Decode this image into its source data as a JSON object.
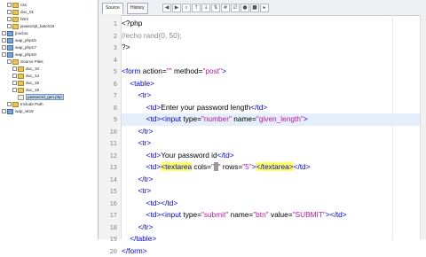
{
  "sidebar": {
    "items": [
      {
        "label": "css",
        "kind": "folder",
        "indent": 1
      },
      {
        "label": "duc_01",
        "kind": "folder",
        "indent": 1
      },
      {
        "label": "html",
        "kind": "folder",
        "indent": 1
      },
      {
        "label": "javascript_batch15",
        "kind": "folder",
        "indent": 1
      },
      {
        "label": "jnuclou",
        "kind": "project",
        "indent": 0
      },
      {
        "label": "wap_php15",
        "kind": "project",
        "indent": 0
      },
      {
        "label": "wap_php17",
        "kind": "project",
        "indent": 0
      },
      {
        "label": "wap_php18",
        "kind": "project",
        "indent": 0
      },
      {
        "label": "Source Files",
        "kind": "folder",
        "indent": 1
      },
      {
        "label": "duc_10",
        "kind": "folder",
        "indent": 2
      },
      {
        "label": "duc_14",
        "kind": "folder",
        "indent": 2
      },
      {
        "label": "duc_15",
        "kind": "folder",
        "indent": 2
      },
      {
        "label": "duc_16",
        "kind": "folder",
        "indent": 2
      },
      {
        "label": "password_gen.php",
        "kind": "file",
        "indent": 3,
        "selected": true
      },
      {
        "label": "Include Path",
        "kind": "folder",
        "indent": 1
      },
      {
        "label": "wap_wt19",
        "kind": "project",
        "indent": 0
      }
    ]
  },
  "toolbar": {
    "source_tab": "Source",
    "history_tab": "History",
    "buttons": [
      "back-icon",
      "forward-icon",
      "find-icon",
      "prev-icon",
      "next-icon",
      "toggle-icon",
      "comment-icon",
      "uncomment-icon",
      "record-icon",
      "stop-icon",
      "play-icon"
    ]
  },
  "editor": {
    "current_line": 9,
    "lines": [
      {
        "n": "1",
        "segments": [
          {
            "t": "<?php",
            "c": "kw"
          }
        ]
      },
      {
        "n": "2",
        "segments": [
          {
            "t": "//echo ",
            "c": "cm"
          },
          {
            "t": "rand",
            "c": "cm"
          },
          {
            "t": "(0, 50);",
            "c": "cm"
          }
        ]
      },
      {
        "n": "3",
        "segments": [
          {
            "t": "?>",
            "c": "kw"
          }
        ]
      },
      {
        "n": "4",
        "segments": []
      },
      {
        "n": "5",
        "segments": [
          {
            "t": "<form ",
            "c": "tag"
          },
          {
            "t": "action=",
            "c": "attr"
          },
          {
            "t": "\"\" ",
            "c": "str"
          },
          {
            "t": "method=",
            "c": "attr"
          },
          {
            "t": "\"post\"",
            "c": "str"
          },
          {
            "t": ">",
            "c": "tag"
          }
        ]
      },
      {
        "n": "6",
        "segments": [
          {
            "t": "    <table>",
            "c": "tag"
          }
        ]
      },
      {
        "n": "7",
        "segments": [
          {
            "t": "        <tr>",
            "c": "tag"
          }
        ]
      },
      {
        "n": "8",
        "segments": [
          {
            "t": "            <td>",
            "c": "tag"
          },
          {
            "t": "Enter your password length",
            "c": "kw"
          },
          {
            "t": "</td>",
            "c": "tag"
          }
        ]
      },
      {
        "n": "9",
        "segments": [
          {
            "t": "            <td><input ",
            "c": "tag"
          },
          {
            "t": "type=",
            "c": "attr"
          },
          {
            "t": "\"number\" ",
            "c": "str"
          },
          {
            "t": "name=",
            "c": "attr"
          },
          {
            "t": "\"given_length\"",
            "c": "str"
          },
          {
            "t": ">",
            "c": "tag"
          }
        ]
      },
      {
        "n": "10",
        "segments": [
          {
            "t": "        </tr>",
            "c": "tag"
          }
        ]
      },
      {
        "n": "11",
        "segments": [
          {
            "t": "        <tr>",
            "c": "tag"
          }
        ]
      },
      {
        "n": "12",
        "segments": [
          {
            "t": "            <td>",
            "c": "tag"
          },
          {
            "t": "Your password id",
            "c": "kw"
          },
          {
            "t": "</td>",
            "c": "tag"
          }
        ]
      },
      {
        "n": "13",
        "segments": [
          {
            "t": "            <td>",
            "c": "tag"
          },
          {
            "t": "<textarea",
            "c": "tag hl-mark"
          },
          {
            "t": " cols=",
            "c": "attr"
          },
          {
            "t": "\"",
            "c": "str"
          },
          {
            "t": "  ",
            "c": "str hl-cursor"
          },
          {
            "t": "\" ",
            "c": "str"
          },
          {
            "t": "rows=",
            "c": "attr"
          },
          {
            "t": "\"5\"",
            "c": "str"
          },
          {
            "t": ">",
            "c": "tag"
          },
          {
            "t": "</textarea>",
            "c": "tag hl-mark"
          },
          {
            "t": "</td>",
            "c": "tag"
          }
        ]
      },
      {
        "n": "14",
        "segments": [
          {
            "t": "        </tr>",
            "c": "tag"
          }
        ]
      },
      {
        "n": "15",
        "segments": [
          {
            "t": "        <tr>",
            "c": "tag"
          }
        ]
      },
      {
        "n": "16",
        "segments": [
          {
            "t": "            <td></td>",
            "c": "tag"
          }
        ]
      },
      {
        "n": "17",
        "segments": [
          {
            "t": "            <td><input ",
            "c": "tag"
          },
          {
            "t": "type=",
            "c": "attr"
          },
          {
            "t": "\"submit\" ",
            "c": "str"
          },
          {
            "t": "name=",
            "c": "attr"
          },
          {
            "t": "\"btn\" ",
            "c": "str"
          },
          {
            "t": "value=",
            "c": "attr"
          },
          {
            "t": "\"SUBMIT\"",
            "c": "str"
          },
          {
            "t": "></td>",
            "c": "tag"
          }
        ]
      },
      {
        "n": "18",
        "segments": [
          {
            "t": "        </tr>",
            "c": "tag"
          }
        ]
      },
      {
        "n": "19",
        "segments": [
          {
            "t": "    </table>",
            "c": "tag"
          }
        ]
      },
      {
        "n": "20",
        "segments": [
          {
            "t": "</form>",
            "c": "tag"
          }
        ]
      }
    ]
  }
}
